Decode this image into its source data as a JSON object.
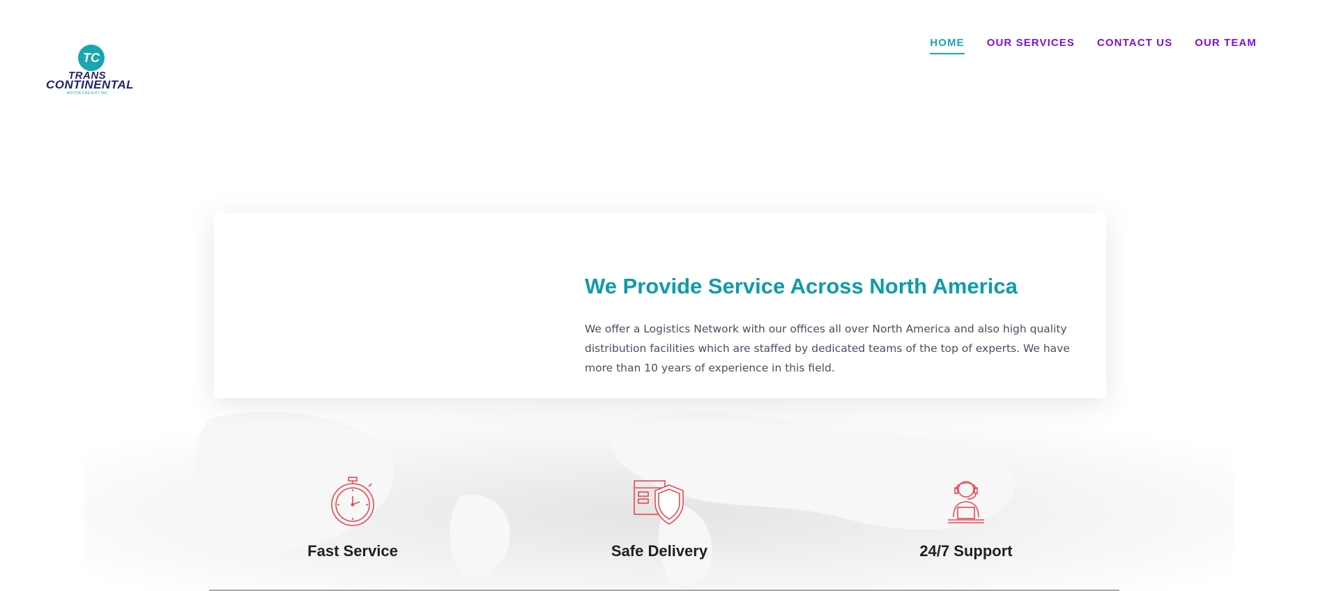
{
  "logo": {
    "mark": "TC",
    "line1": "TRANS",
    "line2": "CONTINENTAL",
    "line3": "MOTOR FREIGHT INC."
  },
  "nav": {
    "items": [
      {
        "label": "HOME",
        "active": true
      },
      {
        "label": "OUR SERVICES",
        "active": false
      },
      {
        "label": "CONTACT US",
        "active": false
      },
      {
        "label": "OUR TEAM",
        "active": false
      }
    ]
  },
  "hero": {
    "title": "We Provide Service Across North America",
    "body": "We offer a Logistics Network with our offices all over North America and also high quality distribution facilities which are staffed by dedicated teams of the top of experts. We have more than 10 years of experience in this field."
  },
  "features": [
    {
      "title": "Fast Service",
      "icon": "stopwatch-icon"
    },
    {
      "title": "Safe Delivery",
      "icon": "package-shield-icon"
    },
    {
      "title": "24/7 Support",
      "icon": "support-agent-icon"
    }
  ],
  "colors": {
    "accent": "#1aa6b0",
    "nav": "#7b12d6",
    "icon": "#e8474f",
    "heading": "#0e9ba8"
  }
}
